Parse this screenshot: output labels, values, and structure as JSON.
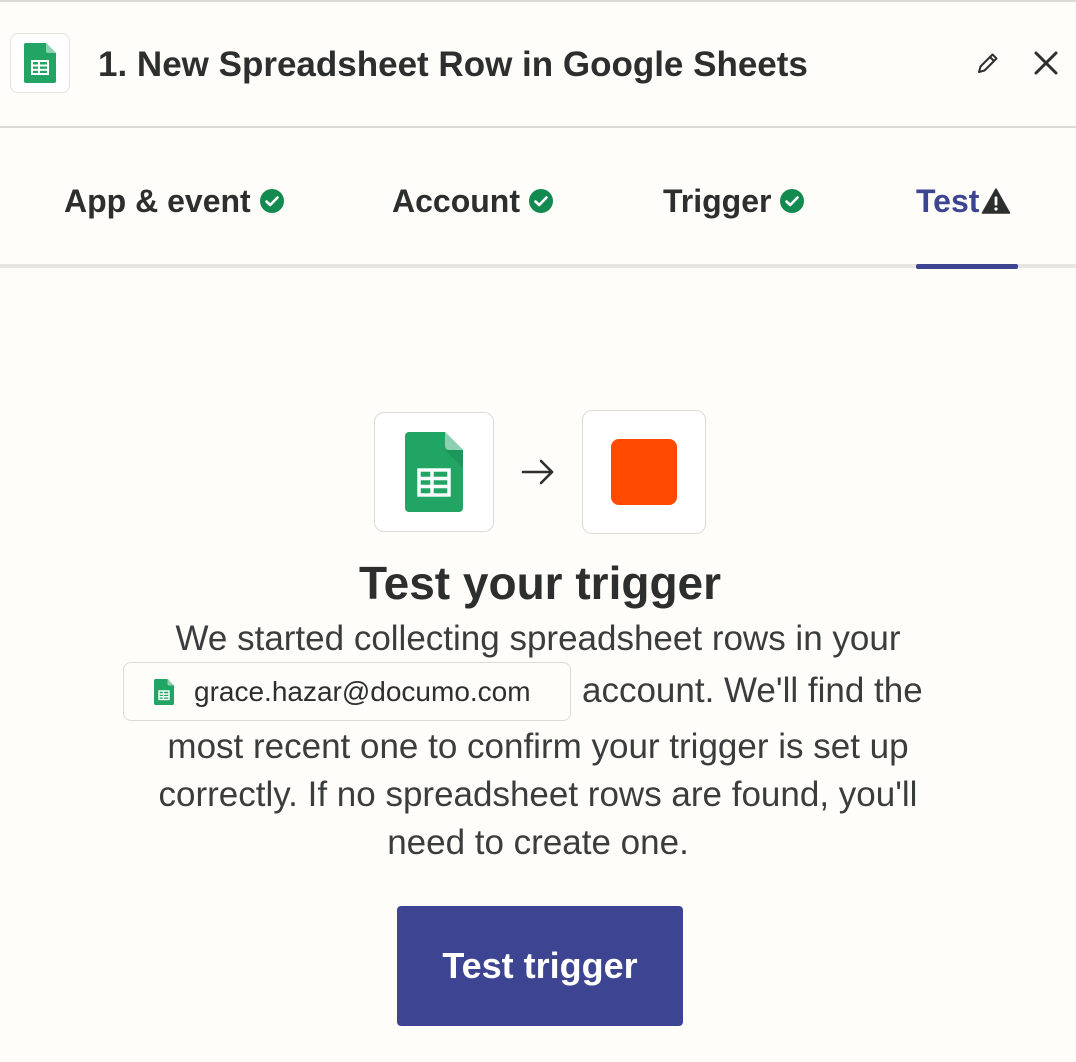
{
  "header": {
    "title": "1. New Spreadsheet Row in Google Sheets",
    "app_icon": "google-sheets-icon",
    "edit_icon": "pencil-icon",
    "close_icon": "close-icon"
  },
  "tabs": [
    {
      "label": "App & event",
      "status_icon": "check-circle-icon",
      "active": false
    },
    {
      "label": "Account",
      "status_icon": "check-circle-icon",
      "active": false
    },
    {
      "label": "Trigger",
      "status_icon": "check-circle-icon",
      "active": false
    },
    {
      "label": "Test",
      "status_icon": "warning-triangle-icon",
      "active": true
    }
  ],
  "flow": {
    "source_icon": "google-sheets-icon",
    "arrow_icon": "arrow-right-icon",
    "target_icon": "zapier-square-icon"
  },
  "main": {
    "heading": "Test your trigger",
    "line1": "We started collecting spreadsheet rows in your",
    "account_email": "grace.hazar@documo.com",
    "line2_rest": "account. We'll find the",
    "line3": "most recent one to confirm your trigger is set up",
    "line4": "correctly. If no spreadsheet rows are found, you'll",
    "line5": "need to create one.",
    "button_label": "Test trigger"
  },
  "colors": {
    "accent": "#3d4592",
    "success": "#138a4f",
    "sheets_green": "#21a464",
    "zapier_orange": "#ff4a00",
    "background": "#fffdf9"
  }
}
